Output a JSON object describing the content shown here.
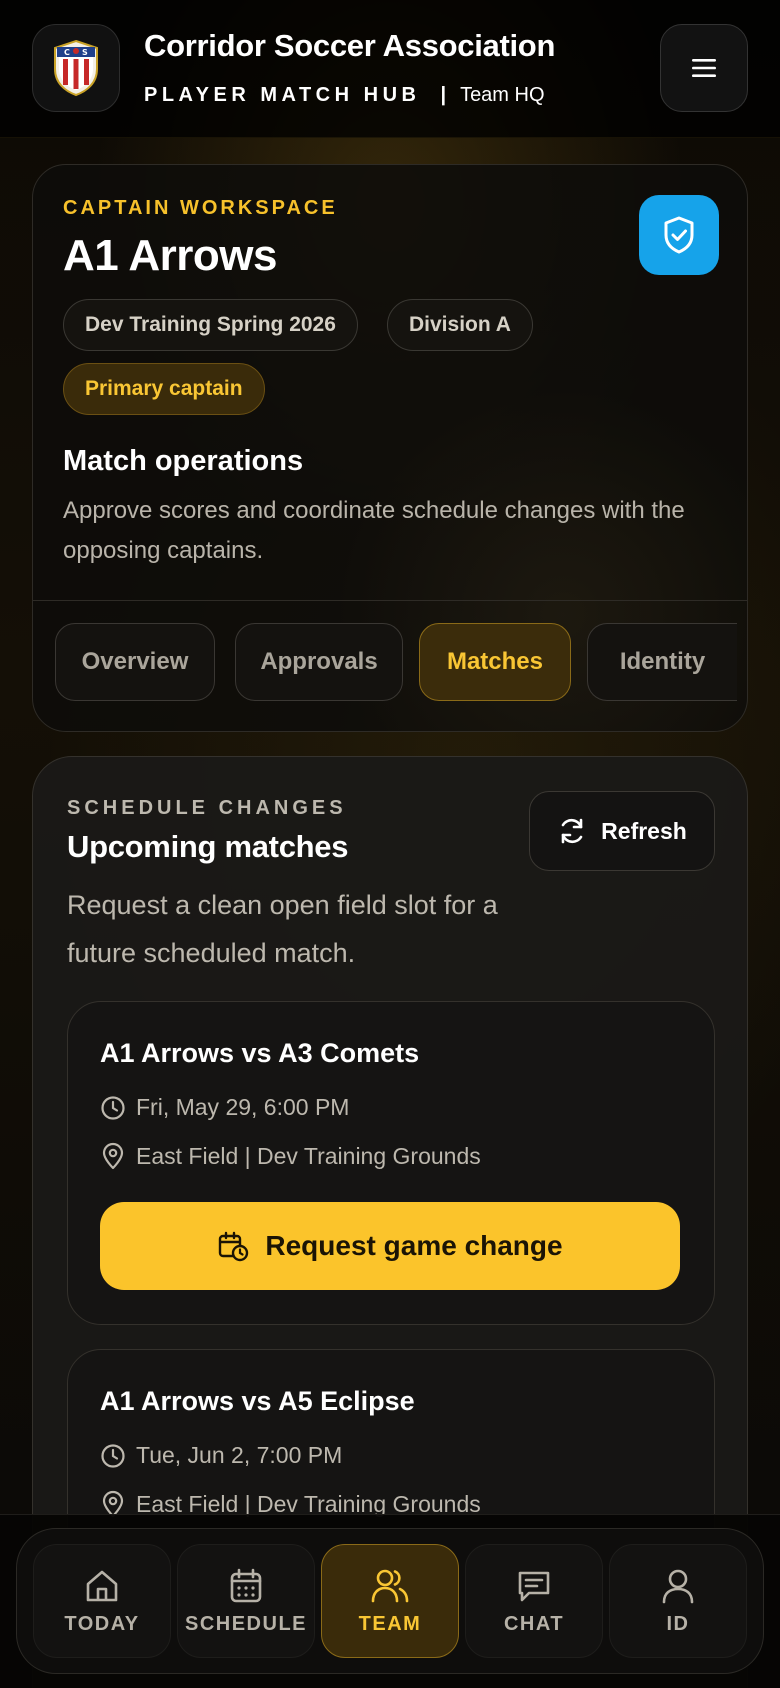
{
  "header": {
    "title": "Corridor Soccer Association",
    "hub_label": "PLAYER MATCH HUB",
    "separator": "|",
    "section": "Team HQ",
    "logo_icon": "shield-crest-logo",
    "menu_icon": "hamburger-menu-icon"
  },
  "workspace": {
    "eyebrow": "CAPTAIN WORKSPACE",
    "team_name": "A1 Arrows",
    "badge_icon": "shield-check-icon",
    "pills": [
      "Dev Training Spring 2026",
      "Division A",
      "Primary captain"
    ],
    "ops_title": "Match operations",
    "ops_desc": "Approve scores and coordinate schedule changes with the opposing captains.",
    "tabs": [
      "Overview",
      "Approvals",
      "Matches",
      "Identity"
    ],
    "active_tab": "Matches"
  },
  "schedule": {
    "eyebrow": "SCHEDULE CHANGES",
    "title": "Upcoming matches",
    "refresh_label": "Refresh",
    "description": "Request a clean open field slot for a future scheduled match.",
    "matches": [
      {
        "title": "A1 Arrows vs A3 Comets",
        "datetime": "Fri, May 29, 6:00 PM",
        "location": "East Field | Dev Training Grounds",
        "action": "Request game change"
      },
      {
        "title": "A1 Arrows vs A5 Eclipse",
        "datetime": "Tue, Jun 2, 7:00 PM",
        "location": "East Field | Dev Training Grounds"
      }
    ]
  },
  "nav": {
    "items": [
      "TODAY",
      "SCHEDULE",
      "TEAM",
      "CHAT",
      "ID"
    ],
    "active": "TEAM"
  },
  "colors": {
    "accent": "#fbc42b",
    "badge_blue": "#16a3ea",
    "background": "#0b0906"
  }
}
